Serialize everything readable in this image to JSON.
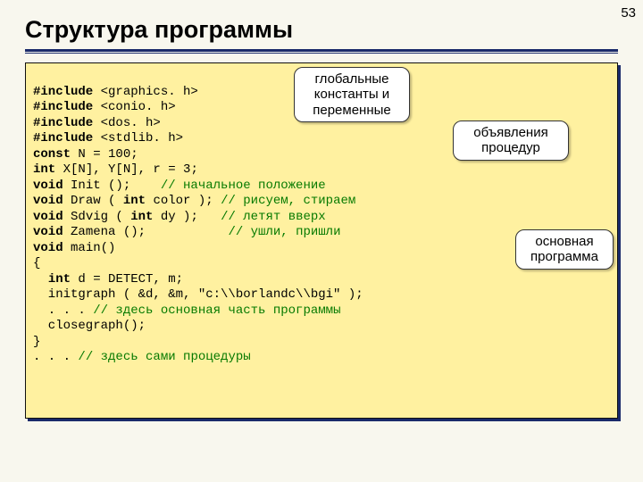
{
  "page_number": "53",
  "title": "Структура программы",
  "annotations": {
    "globals": "глобальные\nконстанты и\nпеременные",
    "decls": "объявления\nпроцедур",
    "main": "основная\nпрограмма"
  },
  "code": {
    "l1a": "#include",
    "l1b": " <graphics. h>",
    "l2a": "#include",
    "l2b": " <conio. h>",
    "l3a": "#include",
    "l3b": " <dos. h>",
    "l4a": "#include",
    "l4b": " <stdlib. h>",
    "l5a": "const",
    "l5b": " N = 100;",
    "l6a": "int",
    "l6b": " X[N], Y[N], r = 3;",
    "l7a": "void",
    "l7b": " Init ();    ",
    "l7c": "// начальное положение",
    "l8a": "void",
    "l8b": " Draw ( ",
    "l8c": "int",
    "l8d": " color ); ",
    "l8e": "// рисуем, стираем",
    "l9a": "void",
    "l9b": " Sdvig ( ",
    "l9c": "int",
    "l9d": " dy );   ",
    "l9e": "// летят вверх",
    "l10a": "void",
    "l10b": " Zamena ();           ",
    "l10c": "// ушли, пришли",
    "l11a": "void",
    "l11b": " main()",
    "l12": "{",
    "l13a": "  ",
    "l13b": "int",
    "l13c": " d = DETECT, m;",
    "l14": "  initgraph ( &d, &m, \"c:\\\\borlandc\\\\bgi\" );",
    "l15a": "  . . . ",
    "l15b": "// здесь основная часть программы",
    "l16": "  closegraph();",
    "l17": "}",
    "l18a": ". . . ",
    "l18b": "// здесь сами процедуры"
  }
}
